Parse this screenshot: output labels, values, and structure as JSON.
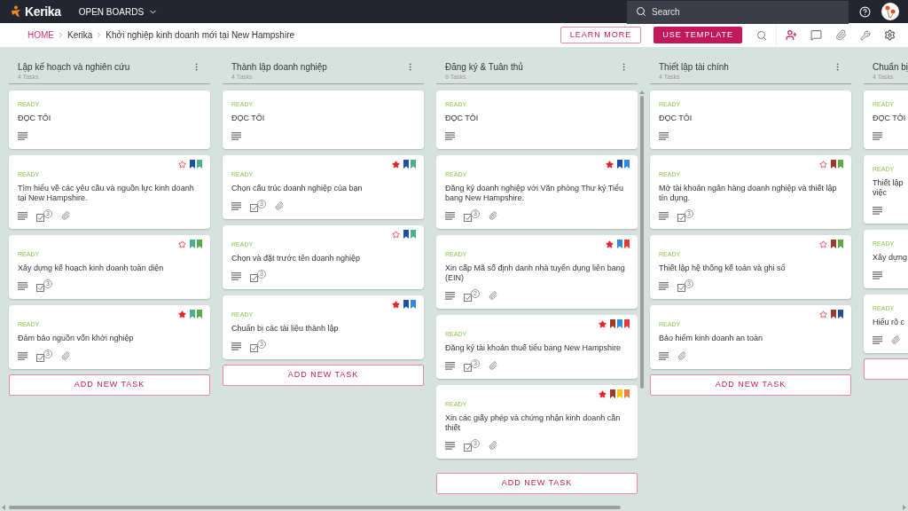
{
  "app": {
    "logo": "Kerika",
    "menu": "OPEN BOARDS",
    "search": {
      "placeholder": "Search"
    }
  },
  "breadcrumb": [
    "HOME",
    "Kerika",
    "Khởi nghiệp kinh doanh mới tại New Hampshire"
  ],
  "actions": {
    "learn_more": "LEARN MORE",
    "use_template": "USE TEMPLATE"
  },
  "columns": [
    {
      "title": "Lập kế hoạch và nghiên cứu",
      "count": "4 Tasks",
      "menu": true,
      "scrolling": false,
      "add_label": "ADD NEW TASK",
      "cards": [
        {
          "status": "READY",
          "title": "ĐỌC TÔI"
        },
        {
          "status": "READY",
          "title": "Tìm hiểu về các yêu cầu và nguồn lực kinh doanh tại New Hampshire.",
          "starred": false,
          "tags": [
            {
              "color": "#1e4fa3"
            },
            {
              "color": "#4caf8f"
            }
          ],
          "checklist": "3",
          "attachment": true
        },
        {
          "status": "READY",
          "title": "Xây dựng kế hoạch kinh doanh toàn diện",
          "starred": false,
          "tags": [
            {
              "color": "#4caf8f"
            },
            {
              "color": "#5bab46"
            }
          ],
          "checklist": "3",
          "attachment": false
        },
        {
          "status": "READY",
          "title": "Đảm bảo nguồn vốn khởi nghiệp",
          "starred": true,
          "tags": [
            {
              "color": "#4caf8f"
            },
            {
              "color": "#5bab46"
            }
          ],
          "checklist": "3",
          "attachment": true
        }
      ]
    },
    {
      "title": "Thành lập doanh nghiệp",
      "count": "4 Tasks",
      "menu": true,
      "scrolling": false,
      "add_label": "ADD NEW TASK",
      "cards": [
        {
          "status": "READY",
          "title": "ĐỌC TÔI"
        },
        {
          "status": "READY",
          "title": "Chọn cấu trúc doanh nghiệp của bạn",
          "starred": true,
          "tags": [
            {
              "color": "#1e4fa3"
            },
            {
              "color": "#4caf8f"
            }
          ],
          "checklist": "3",
          "attachment": true
        },
        {
          "status": "READY",
          "title": "Chọn và đặt trước tên doanh nghiệp",
          "starred": false,
          "tags": [
            {
              "color": "#1e4fa3"
            },
            {
              "color": "#4caf8f"
            }
          ],
          "checklist": "3",
          "attachment": false
        },
        {
          "status": "READY",
          "title": "Chuẩn bị các tài liệu thành lập",
          "starred": true,
          "tags": [
            {
              "color": "#1e4fa3"
            },
            {
              "color": "#2f8be0"
            }
          ],
          "checklist": "3",
          "attachment": false
        }
      ]
    },
    {
      "title": "Đăng ký & Tuân thủ",
      "count": "6 Tasks",
      "menu": true,
      "scrolling": true,
      "add_label": "ADD NEW TASK",
      "cards": [
        {
          "status": "READY",
          "title": "ĐỌC TÔI"
        },
        {
          "status": "READY",
          "title": "Đăng ký doanh nghiệp với Văn phòng Thư ký Tiểu bang New Hampshire.",
          "starred": true,
          "tags": [
            {
              "color": "#1e4fa3"
            },
            {
              "color": "#2f8be0"
            }
          ],
          "checklist": "3",
          "attachment": true
        },
        {
          "status": "READY",
          "title": "Xin cấp Mã số định danh nhà tuyển dụng liên bang (EIN)",
          "starred": true,
          "tags": [
            {
              "color": "#2f8be0"
            },
            {
              "color": "#e53935"
            }
          ],
          "checklist": "2",
          "attachment": true
        },
        {
          "status": "READY",
          "title": "Đăng ký tài khoản thuế tiểu bang New Hampshire",
          "starred": true,
          "tags": [
            {
              "color": "#a0392b"
            },
            {
              "color": "#2f8be0"
            },
            {
              "color": "#e53935"
            }
          ],
          "checklist": "3",
          "attachment": true
        },
        {
          "status": "READY",
          "title": "Xin các giấy phép và chứng nhận kinh doanh cần thiết",
          "starred": true,
          "tags": [
            {
              "color": "#a0392b"
            },
            {
              "color": "#f5c518"
            },
            {
              "color": "#ef7d3c"
            }
          ],
          "checklist": "3",
          "attachment": true
        }
      ]
    },
    {
      "title": "Thiết lập tài chính",
      "count": "4 Tasks",
      "menu": true,
      "scrolling": false,
      "add_label": "ADD NEW TASK",
      "cards": [
        {
          "status": "READY",
          "title": "ĐỌC TÔI"
        },
        {
          "status": "READY",
          "title": "Mở tài khoản ngân hàng doanh nghiệp và thiết lập tín dụng.",
          "starred": false,
          "tags": [
            {
              "color": "#a0392b"
            },
            {
              "color": "#5bab46"
            }
          ],
          "checklist": "3",
          "attachment": false
        },
        {
          "status": "READY",
          "title": "Thiết lập hệ thống kế toán và ghi sổ",
          "starred": false,
          "tags": [
            {
              "color": "#a0392b"
            },
            {
              "color": "#5bab46"
            }
          ],
          "checklist": "3",
          "attachment": false
        },
        {
          "status": "READY",
          "title": "Bảo hiểm kinh doanh an toàn",
          "starred": false,
          "tags": [
            {
              "color": "#a0392b"
            },
            {
              "color": "#1e4fa3"
            }
          ],
          "attachment": true
        }
      ]
    },
    {
      "title": "Chuẩn bị",
      "count": "4 Tasks",
      "menu": false,
      "scrolling": false,
      "cards": [
        {
          "status": "READY",
          "title": "ĐỌC TÔI"
        },
        {
          "status": "READY",
          "title": "Thiết lập\nviệc",
          "attachment": false
        },
        {
          "status": "READY",
          "title": "Xây dựng",
          "attachment": false
        },
        {
          "status": "READY",
          "title": "Hiểu rõ c",
          "attachment": true
        }
      ]
    }
  ]
}
